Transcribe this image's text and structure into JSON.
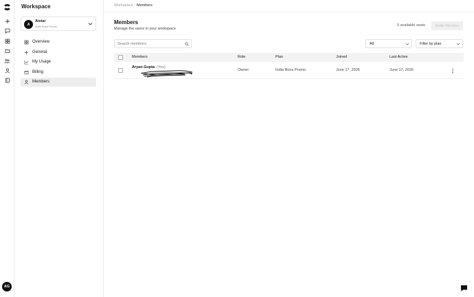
{
  "rail": {
    "icons": [
      "logo-icon",
      "plus-icon",
      "chat-icon",
      "grid-icon",
      "folder-icon",
      "team-icon",
      "user-icon",
      "book-icon"
    ],
    "user_initials": "AG"
  },
  "sidebar": {
    "title": "Workspace",
    "workspace": {
      "initial": "A",
      "name": "Aistar",
      "subtitle": "India Runs Promo"
    },
    "items": [
      {
        "label": "Overview",
        "icon": "overview-icon"
      },
      {
        "label": "General",
        "icon": "plus-icon"
      },
      {
        "label": "My Usage",
        "icon": "chart-icon"
      },
      {
        "label": "Billing",
        "icon": "billing-icon"
      },
      {
        "label": "Members",
        "icon": "user-icon",
        "active": true
      }
    ]
  },
  "breadcrumb": {
    "parent": "Workspace",
    "separator": "/",
    "current": "Members"
  },
  "header": {
    "title": "Members",
    "subtitle": "Manage the users in your workspace",
    "seats": "0 available seats",
    "invite_label": "Invite Member"
  },
  "filters": {
    "search_placeholder": "Search members",
    "role_filter": "All",
    "plan_filter": "Filter by plan"
  },
  "table": {
    "headers": {
      "members": "Members",
      "role": "Role",
      "plan": "Plan",
      "joined": "Joined",
      "last_active": "Last Active"
    },
    "rows": [
      {
        "name": "Aryan Gupta",
        "you": "(You)",
        "role": "Owner",
        "plan": "India Runs Promo",
        "joined": "June 17, 2026",
        "last_active": "June 17, 2026"
      }
    ]
  },
  "colors": {
    "accent": "#111111",
    "muted": "#999999",
    "active_bg": "#ededed"
  }
}
